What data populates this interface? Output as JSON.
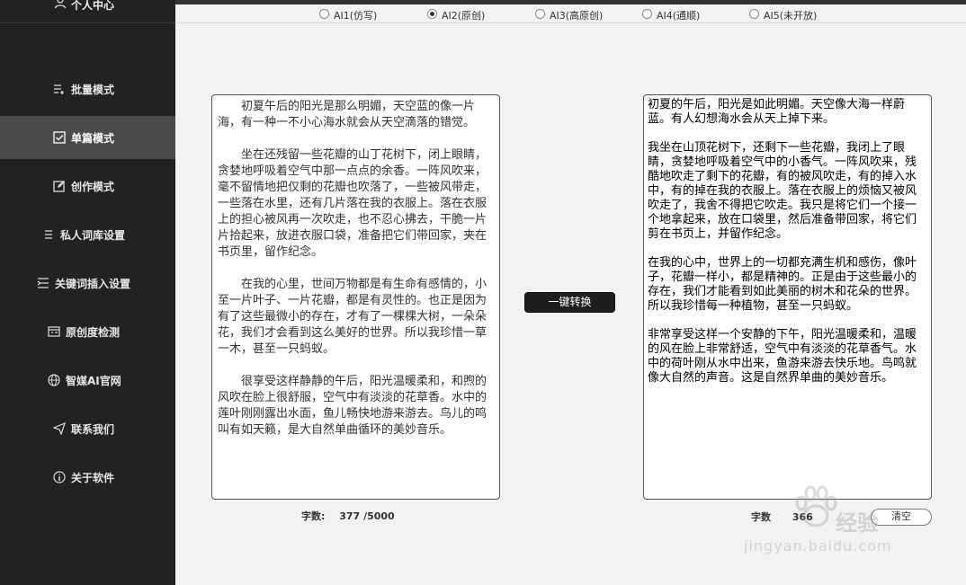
{
  "sidebar": {
    "top_label": "个人中心",
    "items": [
      {
        "label": "批量模式",
        "icon": "list-add-icon",
        "active": false
      },
      {
        "label": "单篇模式",
        "icon": "check-square-icon",
        "active": true
      },
      {
        "label": "创作模式",
        "icon": "edit-icon",
        "active": false
      },
      {
        "label": "私人词库设置",
        "icon": "list-icon",
        "active": false
      },
      {
        "label": "关键词插入设置",
        "icon": "insert-icon",
        "active": false
      },
      {
        "label": "原创度检测",
        "icon": "detect-icon",
        "active": false
      },
      {
        "label": "智媒AI官网",
        "icon": "globe-icon",
        "active": false
      },
      {
        "label": "联系我们",
        "icon": "send-icon",
        "active": false
      },
      {
        "label": "关于软件",
        "icon": "info-icon",
        "active": false
      }
    ]
  },
  "modes": [
    {
      "label": "AI1(仿写)",
      "checked": false
    },
    {
      "label": "AI2(原创)",
      "checked": true
    },
    {
      "label": "AI3(高原创)",
      "checked": false
    },
    {
      "label": "AI4(通顺)",
      "checked": false
    },
    {
      "label": "AI5(未开放)",
      "checked": false
    }
  ],
  "source": {
    "paragraphs": [
      "初夏午后的阳光是那么明媚，天空蓝的像一片海，有一种一不小心海水就会从天空滴落的错觉。",
      "坐在还残留一些花瓣的山丁花树下，闭上眼睛，贪婪地呼吸着空气中那一点点的余香。一阵风吹来，毫不留情地把仅剩的花瓣也吹落了，一些被风带走，一些落在水里，还有几片落在我的衣服上。落在衣服上的担心被风再一次吹走，也不忍心拂去，干脆一片片拾起来，放进衣服口袋，准备把它们带回家，夹在书页里，留作纪念。",
      "在我的心里，世间万物都是有生命有感情的，小至一片叶子、一片花瓣，都是有灵性的。也正是因为有了这些最微小的存在，才有了一棵棵大树，一朵朵花，我们才会看到这么美好的世界。所以我珍惜一草一木，甚至一只蚂蚁。",
      "很享受这样静静的午后，阳光温暖柔和，和煦的风吹在脸上很舒服，空气中有淡淡的花草香。水中的莲叶刚刚露出水面，鱼儿畅快地游来游去。鸟儿的鸣叫有如天籁，是大自然单曲循环的美妙音乐。"
    ],
    "count_label": "字数:",
    "count_value": "377",
    "count_max": "/5000"
  },
  "convert_label": "一键转换",
  "result": {
    "paragraphs": [
      "初夏的午后，阳光是如此明媚。天空像大海一样蔚蓝。有人幻想海水会从天上掉下来。",
      "我坐在山顶花树下，还剩下一些花瓣，我闭上了眼睛，贪婪地呼吸着空气中的小香气。一阵风吹来，残酷地吹走了剩下的花瓣，有的被风吹走，有的掉入水中，有的掉在我的衣服上。落在衣服上的烦恼又被风吹走了，我舍不得把它吹走。我只是将它们一个接一个地拿起来，放在口袋里，然后准备带回家，将它们剪在书页上，并留作纪念。",
      "在我的心中，世界上的一切都充满生机和感伤，像叶子，花瓣一样小，都是精神的。正是由于这些最小的存在，我们才能看到如此美丽的树木和花朵的世界。所以我珍惜每一种植物，甚至一只蚂蚁。",
      "非常享受这样一个安静的下午，阳光温暖柔和，温暖的风在脸上非常舒适，空气中有淡淡的花草香气。水中的荷叶刚从水中出来，鱼游来游去快乐地。鸟鸣就像大自然的声音。这是自然界单曲的美妙音乐。"
    ],
    "count_label": "字数",
    "count_value": "366",
    "clear_label": "清空"
  },
  "watermark": {
    "text": "经验",
    "url": "jingyan.baidu.com"
  }
}
